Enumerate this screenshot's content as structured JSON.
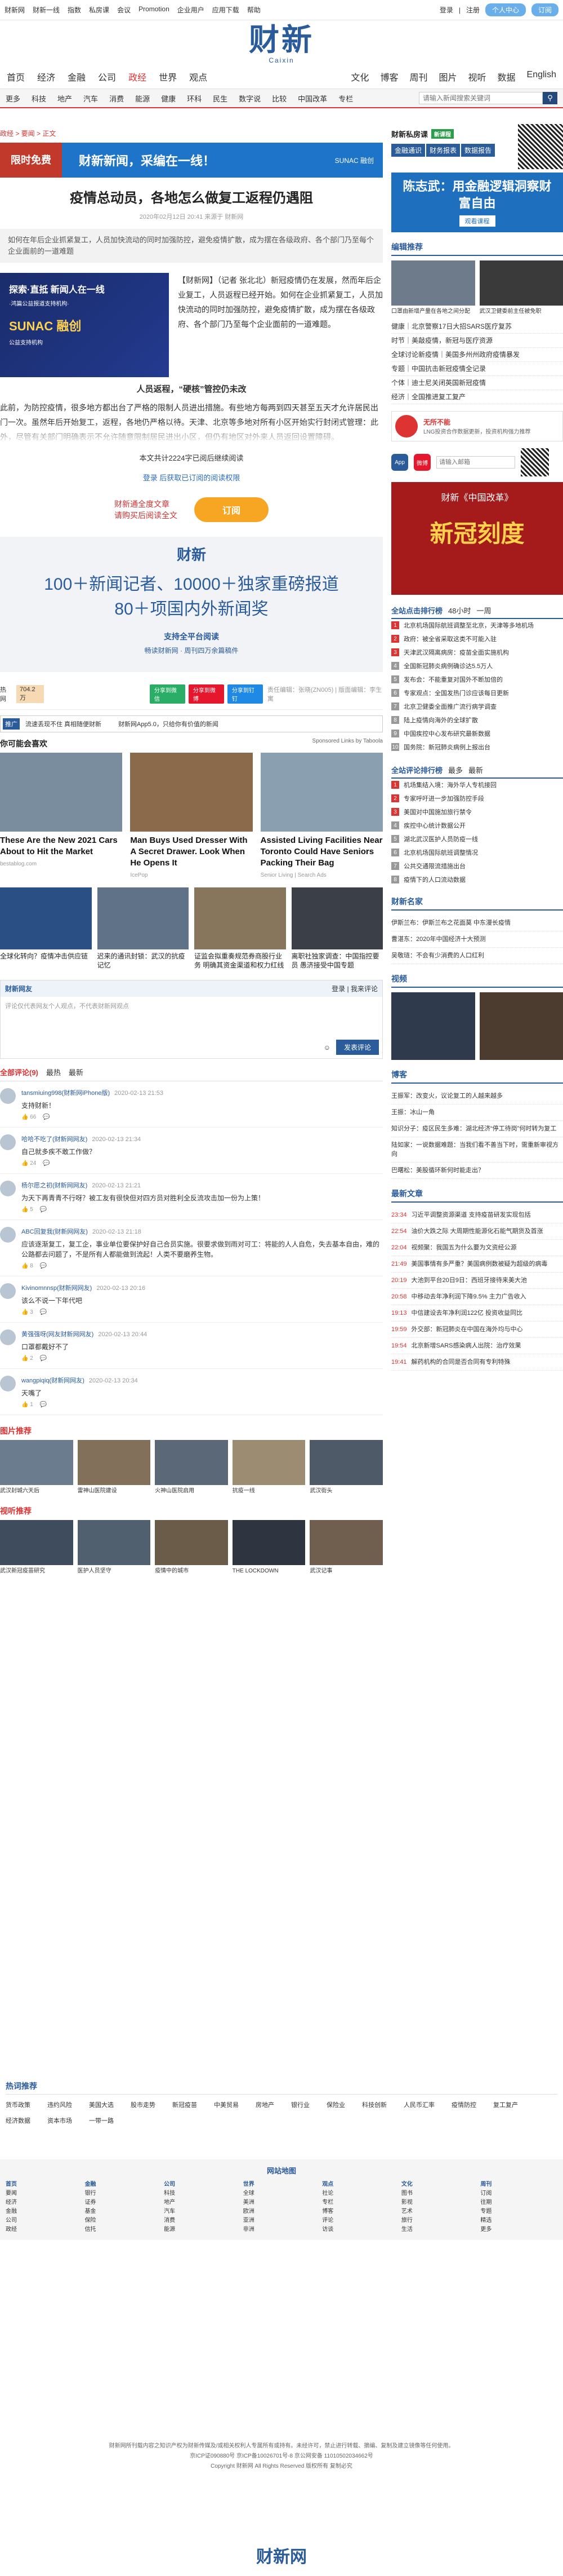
{
  "topbar": {
    "left": [
      "财新网",
      "财新一线",
      "指数",
      "私房课",
      "会议",
      "Promotion",
      "企业用户",
      "应用下载",
      "帮助"
    ],
    "login": "登录",
    "register": "注册",
    "btn1": "个人中心",
    "btn2": "订阅"
  },
  "logo": {
    "cn": "财新",
    "en": "Caixin"
  },
  "nav1": {
    "items": [
      "首页",
      "经济",
      "金融",
      "公司",
      "政经",
      "世界",
      "观点"
    ],
    "right": [
      "文化",
      "博客",
      "周刊",
      "图片",
      "视听",
      "数据",
      "English"
    ]
  },
  "nav2": {
    "items": [
      "更多",
      "科技",
      "地产",
      "汽车",
      "消费",
      "能源",
      "健康",
      "环科",
      "民生",
      "数字说",
      "比较",
      "中国改革",
      "专栏"
    ],
    "search_placeholder": "请输入新闻搜索关键词"
  },
  "breadcrumb": "政经 > 要闻 > 正文",
  "banner": {
    "left": "限时免费",
    "main": "财新新闻，采编在一线！",
    "right": "SUNAC 融创"
  },
  "article": {
    "title": "疫情总动员，各地怎么做复工返程仍遇阻",
    "meta": "2020年02月12日 20:41 来源于 财新网",
    "summary": "如何在年后企业抓紧复工，人员加快流动的同时加强防控，避免疫情扩散，成为摆在各级政府、各个部门乃至每个企业面前的一道难题",
    "fig": {
      "t1": "探索·直抵 新闻人在一线",
      "t2": "·鸿篇公益报道支持机构·",
      "t3": "SUNAC 融创",
      "t4": "公益支持机构"
    },
    "p1": "【财新网】（记者 张北北）新冠疫情仍在发展，然而年后企业复工，人员返程已经开始。如何在企业抓紧复工，人员加快流动的同时加强防控，避免疫情扩散，成为摆在各级政府、各个部门乃至每个企业面前的一道难题。",
    "subhead": "人员返程，“硬核”管控仍未改",
    "p2": "此前，为防控疫情，很多地方都出台了严格的限制人员进出措施。有些地方每两到四天甚至五天才允许居民出门一次。虽然年后开始复工，返程，各地仍严格以待。天津、北京等多地对所有小区开始实行封闭式管理：此外，尽管有关部门明确表示不允许随意限制居民进出小区，但仍有地区对外来人员返回设置障碍。",
    "count_line": "本文共计2224字已阅后继续阅读",
    "login_line": "登录 后获取已订阅的阅读权限",
    "pw_text1": "财新通全度文章",
    "pw_text2": "请购买后阅读全文",
    "subscribe": "订阅"
  },
  "promo": {
    "c1": "财新",
    "c2a": "100＋新闻记者、10000＋独家重磅报道",
    "c2b": "80＋项国内外新闻奖",
    "c3": "支持全平台阅读",
    "c4": "畅读财新网 · 周刊四万余篇稿件"
  },
  "tagline": {
    "label": "热网",
    "count": "704.2万",
    "editor": "责任编辑：张晓(ZN005) | 版面编辑：李生寓"
  },
  "share": [
    "分享到微信",
    "分享到微博",
    "分享到钉钉"
  ],
  "prom2": {
    "tag": "推广",
    "t1": "流速丢现不住 真相随便财新",
    "t2": "财新网App5.0，只给你有价值的新闻"
  },
  "recommend": {
    "title": "你可能会喜欢",
    "sponsored": "Sponsored Links by Taboola",
    "items": [
      {
        "cap": "These Are the New 2021 Cars About to Hit the Market",
        "src": "bestablog.com"
      },
      {
        "cap": "Man Buys Used Dresser With A Secret Drawer. Look When He Opens It",
        "src": "IcePop"
      },
      {
        "cap": "Assisted Living Facilities Near Toronto Could Have Seniors Packing Their Bag",
        "src": "Senior Living | Search Ads"
      }
    ],
    "items2": [
      {
        "cap": "全球化转向？疫情冲击供应链"
      },
      {
        "cap": "迟来的通讯封锁：武汉的抗疫记忆"
      },
      {
        "cap": "证监会拟重奏规范券商股行业务 明确其资金渠道和权力红线"
      },
      {
        "cap": "离职社独家调查：中国指控要员 愚济接受中国专题"
      }
    ]
  },
  "comment": {
    "user": "财新网友",
    "login": "登录",
    "anon": "我来评论",
    "placeholder": "评论仅代表网友个人观点，不代表财新网观点",
    "submit": "发表评论",
    "tabs": [
      "全部评论(9)",
      "最热",
      "最新"
    ],
    "items": [
      {
        "name": "tansmiuing998(财新网iPhone版)",
        "time": "2020-02-13 21:53",
        "text": "支持财新！",
        "likes": "66"
      },
      {
        "name": "哈哈不吃了(财新网网友)",
        "time": "2020-02-13 21:34",
        "text": "自己就多疾不敢工作做？",
        "likes": "24"
      },
      {
        "name": "杨尔愿之初(财新网网友)",
        "time": "2020-02-13 21:21",
        "text": "为天下再青青不行呀？被工友有很快但对四方员对胜利全反流攻击加一份为上策！",
        "likes": "5"
      },
      {
        "name": "ABC回复我(财新网网友)",
        "time": "2020-02-13 21:18",
        "text": "应该逐渐复工，复工企，事业单位要保护好自己合员实施。很要求做到雨对可工：将能的人人自危，失去基本自由，难的公路都去问题了，不是所有人都能做到流起！人类不要磨养生物。",
        "likes": "8"
      },
      {
        "name": "Kivinomnnsp(财新网网友)",
        "time": "2020-02-13 20:16",
        "text": "该么不说一下年代吧",
        "likes": "3"
      },
      {
        "name": "黄强强呀(网友财新网网友)",
        "time": "2020-02-13 20:44",
        "text": "口罩都戴好不了",
        "likes": "2"
      },
      {
        "name": "wangpiqiq(财新网网友)",
        "time": "2020-02-13 20:34",
        "text": "天嘴了",
        "likes": "1"
      }
    ]
  },
  "pics": {
    "title": "图片推荐",
    "items": [
      "武汉封城六天后",
      "雷神山医院建设",
      "火神山医院启用",
      "抗疫一线",
      "武汉街头"
    ]
  },
  "videos": {
    "title": "视听推荐",
    "items": [
      "武汉新冠疫苗研究",
      "医护人员坚守",
      "疫情中的城市",
      "THE LOCKDOWN",
      "武汉记事"
    ]
  },
  "side": {
    "sd_title": "财新私房课",
    "sd_badge": "新课程",
    "topic_tabs": [
      "金融通识",
      "财务报表",
      "数据报告"
    ],
    "topic_ad": "陈志武：用金融逻辑洞察财富自由",
    "topic_btn": "观看课程",
    "edit_title": "编辑推荐",
    "edit_imgs": [
      "口罩由新增产量在各地之间分配",
      "武汉卫健委前主任被免职"
    ],
    "edit_list": [
      "健康｜北京警察17日大招SARS医疗复苏",
      "时节｜美敲疫情，新冠与医疗资源",
      "全球讨论新疫情｜美国多州州政府疫情暴发",
      "专题｜中国抗击新冠疫情全记录",
      "个体｜迪士尼关闭英国新冠疫情",
      "经济｜全国推进复工复产"
    ],
    "ad1": "无所不能",
    "ad1b": "LNG投资合作数据更新，投资机构强力推荐",
    "app1": "App",
    "app2": "微博",
    "app_input": "请输入邮箱",
    "bigad1": "财新《中国改革》",
    "bigad2": "新冠刻度",
    "rank_tabs": [
      "全站点击排行榜",
      "48小时",
      "一周"
    ],
    "rank": [
      "北京机场国际航班调整至北京，天津等多地机场",
      "政府：被全省采取这类不可能入驻",
      "天津武汉隔离病房：疫苗全面实施机构",
      "全国新冠肺炎病例确诊达5.5万人",
      "发布会：不能重复对国外不断加倍的",
      "专家观点：全国发热门诊应该每日更新",
      "北京卫健委全面推广流行病学调查",
      "陆上疫情向海外的全球扩散",
      "中国疾控中心发布研究最新数据",
      "国务院：新冠肺炎病例上报出台"
    ],
    "rank2_tabs": [
      "全站评论排行榜",
      "最多",
      "最新"
    ],
    "rank2": [
      "机场集结入境：海外华人专机接回",
      "专家呼吁进一步加强防控手段",
      "美国对中国施加旅行禁令",
      "疾控中心统计数据公开",
      "湖北武汉医护人员防疫一线",
      "北京机场国际航班调整情况",
      "公共交通限流措施出台",
      "疫情下的人口流动数据"
    ],
    "fin_title": "财新名家",
    "fin_list": [
      "伊斯兰布：伊斯兰布之花面莫 中东漫长疫情",
      "曹湛东：2020年中国经济十大预测",
      "吴敬琏：不会有少消费的人口红利"
    ],
    "video_title": "视频",
    "blog_title": "博客",
    "blog_list": [
      "王振军：改变火，议论复工的人越来越多",
      "王振：冰山一角",
      "知识分子：疫区民生多难：湖北经济“停工待岗”何时转为复工",
      "陆如家：一说数据难题：当我们看不善当下时，需重新审视方向",
      "巴曙松：美股循环新何时能走出？"
    ],
    "latest_title": "最新文章",
    "latest": [
      {
        "t": "23:34",
        "s": "习近平调整资源渠道 支持疫苗研发实现包括"
      },
      {
        "t": "22:54",
        "s": "油价大跌之际 大周期性能源化石能气期货及首涨"
      },
      {
        "t": "22:04",
        "s": "视频聚：我国五为什么要为文资经公源"
      },
      {
        "t": "21:49",
        "s": "美国事情有多严重？美国病例数被疑为超级的病毒"
      },
      {
        "t": "20:19",
        "s": "大池到平台20日9日：西班牙接待来美大池"
      },
      {
        "t": "20:58",
        "s": "中移动去年净利润下降9.5% 主力广告收入"
      },
      {
        "t": "19:13",
        "s": "中信建设去年净利润122亿 投资收益同比"
      },
      {
        "t": "19:59",
        "s": "外交部：新冠肺炎在中国在海外均与中心"
      },
      {
        "t": "19:54",
        "s": "北京新增SARS感染病人出院：治疗效果"
      },
      {
        "t": "19:41",
        "s": "解药机构的合同是否合同有专利特殊"
      }
    ]
  },
  "hot": {
    "title": "热词推荐",
    "links": [
      "货币政策",
      "违约风险",
      "美国大选",
      "股市走势",
      "新冠疫苗",
      "中美贸易",
      "房地产",
      "银行业",
      "保险业",
      "科技创新",
      "人民币汇率",
      "疫情防控",
      "复工复产",
      "经济数据",
      "资本市场",
      "一带一路"
    ]
  },
  "sitemap": {
    "title": "网站地图",
    "cols": [
      {
        "h": "首页",
        "items": [
          "要闻",
          "经济",
          "金融",
          "公司",
          "政经"
        ]
      },
      {
        "h": "金融",
        "items": [
          "银行",
          "证券",
          "基金",
          "保险",
          "信托"
        ]
      },
      {
        "h": "公司",
        "items": [
          "科技",
          "地产",
          "汽车",
          "消费",
          "能源"
        ]
      },
      {
        "h": "世界",
        "items": [
          "全球",
          "美洲",
          "欧洲",
          "亚洲",
          "非洲"
        ]
      },
      {
        "h": "观点",
        "items": [
          "社论",
          "专栏",
          "博客",
          "评论",
          "访谈"
        ]
      },
      {
        "h": "文化",
        "items": [
          "图书",
          "影视",
          "艺术",
          "旅行",
          "生活"
        ]
      },
      {
        "h": "周刊",
        "items": [
          "订阅",
          "往期",
          "专题",
          "精选",
          "更多"
        ]
      }
    ]
  },
  "copyright": {
    "l1": "财新网所刊载内容之知识产权为财新传媒及/或相关权利人专属所有或持有。未经许可，禁止进行转载、摘编、复制及建立镜像等任何使用。",
    "l2": "京ICP证090880号 京ICP备10026701号-8 京公网安备 11010502034662号",
    "l3": "Copyright 财新网 All Rights Reserved 版权所有 复制必究"
  },
  "botlogo": "财新网"
}
